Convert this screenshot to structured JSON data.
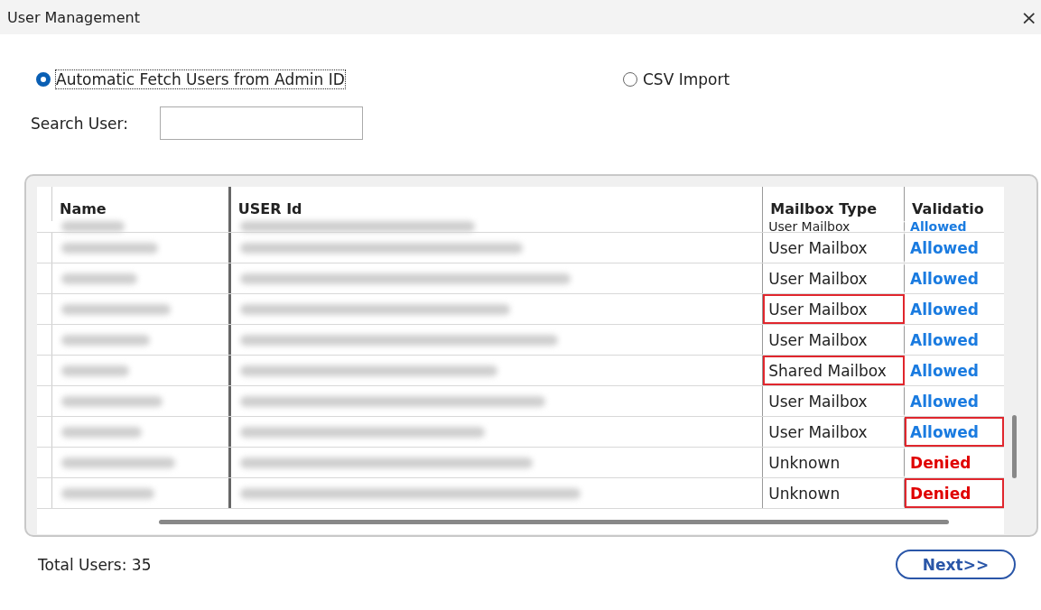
{
  "window": {
    "title": "User Management",
    "close": "×"
  },
  "source_options": [
    {
      "label": "Automatic Fetch Users from Admin ID",
      "selected": true,
      "focused": true
    },
    {
      "label": "CSV Import",
      "selected": false,
      "focused": false
    }
  ],
  "search": {
    "label": "Search User:"
  },
  "table": {
    "columns": [
      "Name",
      "USER Id",
      "Mailbox Type",
      "Validatio"
    ],
    "rows": [
      {
        "blurred": true,
        "mailbox_type": "User Mailbox",
        "mailbox_highlighted": false,
        "validation": "Allowed",
        "color": "#1a7be0",
        "validation_highlighted": false,
        "partial": true
      },
      {
        "blurred": true,
        "mailbox_type": "User Mailbox",
        "mailbox_highlighted": false,
        "validation": "Allowed",
        "color": "#1a7be0",
        "validation_highlighted": false,
        "partial": false
      },
      {
        "blurred": true,
        "mailbox_type": "User Mailbox",
        "mailbox_highlighted": false,
        "validation": "Allowed",
        "color": "#1a7be0",
        "validation_highlighted": false,
        "partial": false
      },
      {
        "blurred": true,
        "mailbox_type": "User Mailbox",
        "mailbox_highlighted": true,
        "validation": "Allowed",
        "color": "#1a7be0",
        "validation_highlighted": false,
        "partial": false
      },
      {
        "blurred": true,
        "mailbox_type": "User Mailbox",
        "mailbox_highlighted": false,
        "validation": "Allowed",
        "color": "#1a7be0",
        "validation_highlighted": false,
        "partial": false
      },
      {
        "blurred": true,
        "mailbox_type": "Shared Mailbox",
        "mailbox_highlighted": true,
        "validation": "Allowed",
        "color": "#1a7be0",
        "validation_highlighted": false,
        "partial": false
      },
      {
        "blurred": true,
        "mailbox_type": "User Mailbox",
        "mailbox_highlighted": false,
        "validation": "Allowed",
        "color": "#1a7be0",
        "validation_highlighted": false,
        "partial": false
      },
      {
        "blurred": true,
        "mailbox_type": "User Mailbox",
        "mailbox_highlighted": false,
        "validation": "Allowed",
        "color": "#1a7be0",
        "validation_highlighted": true,
        "partial": false
      },
      {
        "blurred": true,
        "mailbox_type": "Unknown",
        "mailbox_highlighted": false,
        "validation": "Denied",
        "color": "#e00000",
        "validation_highlighted": false,
        "partial": false
      },
      {
        "blurred": true,
        "mailbox_type": "Unknown",
        "mailbox_highlighted": false,
        "validation": "Denied",
        "color": "#e00000",
        "validation_highlighted": true,
        "partial": false
      }
    ]
  },
  "total": "Total Users: 35",
  "next_button": "Next>>"
}
